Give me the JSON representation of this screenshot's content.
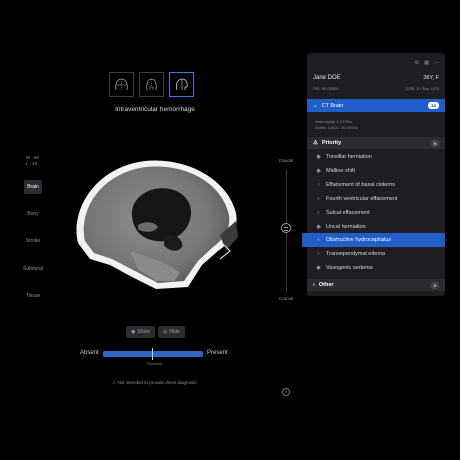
{
  "finding_title": "Intraventricular hemorrhage",
  "window_level": {
    "w": "W : 80",
    "l": "L : 40"
  },
  "presets": [
    "Brain",
    "Bony",
    "Stroke",
    "Subdural",
    "Tissue"
  ],
  "active_preset": "Brain",
  "slice_slider": {
    "top_label": "Caudal",
    "bottom_label": "Cranial"
  },
  "toggles": {
    "show": "Show",
    "hide": "Hide"
  },
  "threshold": {
    "left": "Absent",
    "right": "Present",
    "caption": "Threshold",
    "value_fraction": 0.5
  },
  "disclaimer": "Not intended to provide direct diagnosis.",
  "patient": {
    "name": "Jane DOE",
    "age_sex": "36Y, F",
    "pid": "PID: 00.00000",
    "dob": "DOB: 10 Sep 1974"
  },
  "study": {
    "title": "CT Brain",
    "count": "14",
    "meta_line1": "Head spiral 1.0 H31s",
    "meta_line2": "Series 3   ACC: 00.00000"
  },
  "priority": {
    "label": "Priority",
    "count": "9",
    "items": [
      {
        "label": "Tonsillar herniation",
        "icon": "eye-icon"
      },
      {
        "label": "Midline shift",
        "icon": "eye-icon"
      },
      {
        "label": "Effacement of basal cisterns",
        "icon": "chevron-left-icon"
      },
      {
        "label": "Fourth ventricular effacement",
        "icon": "chevron-left-icon"
      },
      {
        "label": "Sulcal effacement",
        "icon": "chevron-left-icon"
      },
      {
        "label": "Uncal herniation",
        "icon": "eye-icon"
      },
      {
        "label": "Obstructive hydrocephalus",
        "icon": "chevron-left-icon",
        "selected": true
      },
      {
        "label": "Transependymal edema",
        "icon": "chevron-left-icon"
      },
      {
        "label": "Vasogenic oedema",
        "icon": "eye-icon"
      }
    ]
  },
  "other": {
    "label": "Other",
    "count": "5"
  }
}
